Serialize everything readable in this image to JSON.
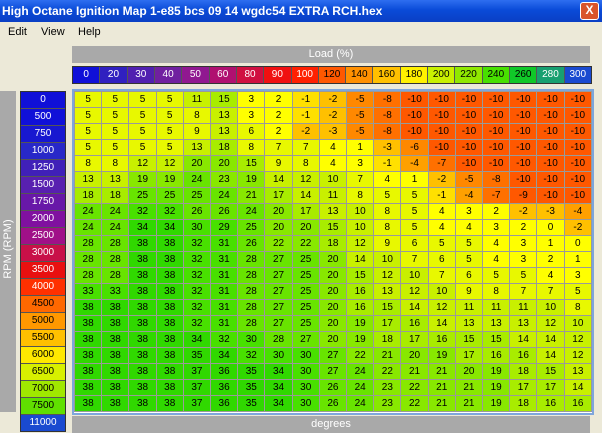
{
  "window": {
    "title": "High Octane Ignition Map 1-e85  bcs 09 14 wgdc54 EXTRA RCH.hex",
    "close_label": "X"
  },
  "menu": [
    "Edit",
    "View",
    "Help"
  ],
  "x_axis_label": "Load (%)",
  "y_axis_label": "RPM (RPM)",
  "bottom_label": "degrees",
  "load_columns": [
    {
      "label": "0",
      "color": "#1010d8",
      "text": "#ffffff"
    },
    {
      "label": "20",
      "color": "#3020c0",
      "text": "#ffffff"
    },
    {
      "label": "30",
      "color": "#5020b0",
      "text": "#ffffff"
    },
    {
      "label": "40",
      "color": "#7020a0",
      "text": "#ffffff"
    },
    {
      "label": "50",
      "color": "#901890",
      "text": "#ffffff"
    },
    {
      "label": "60",
      "color": "#b01070",
      "text": "#ffffff"
    },
    {
      "label": "80",
      "color": "#d01040",
      "text": "#ffffff"
    },
    {
      "label": "90",
      "color": "#f01010",
      "text": "#ffffff"
    },
    {
      "label": "100",
      "color": "#ff2000",
      "text": "#ffffff"
    },
    {
      "label": "120",
      "color": "#ff5800",
      "text": "#000000"
    },
    {
      "label": "140",
      "color": "#ff9000",
      "text": "#000000"
    },
    {
      "label": "160",
      "color": "#ffc000",
      "text": "#000000"
    },
    {
      "label": "180",
      "color": "#fff000",
      "text": "#000000"
    },
    {
      "label": "200",
      "color": "#c8f000",
      "text": "#000000"
    },
    {
      "label": "220",
      "color": "#90e800",
      "text": "#000000"
    },
    {
      "label": "240",
      "color": "#48e000",
      "text": "#000000"
    },
    {
      "label": "260",
      "color": "#10c828",
      "text": "#000000"
    },
    {
      "label": "280",
      "color": "#18a070",
      "text": "#ffffff"
    },
    {
      "label": "300",
      "color": "#1a4ad0",
      "text": "#ffffff"
    }
  ],
  "rpm_rows": [
    {
      "label": "0",
      "color": "#1010d8",
      "text": "#ffffff"
    },
    {
      "label": "500",
      "color": "#1010d8",
      "text": "#ffffff"
    },
    {
      "label": "750",
      "color": "#1818d0",
      "text": "#ffffff"
    },
    {
      "label": "1000",
      "color": "#2828c8",
      "text": "#ffffff"
    },
    {
      "label": "1250",
      "color": "#4020b8",
      "text": "#ffffff"
    },
    {
      "label": "1500",
      "color": "#5820b0",
      "text": "#ffffff"
    },
    {
      "label": "1750",
      "color": "#6818a8",
      "text": "#ffffff"
    },
    {
      "label": "2000",
      "color": "#8010a0",
      "text": "#ffffff"
    },
    {
      "label": "2500",
      "color": "#a01088",
      "text": "#ffffff"
    },
    {
      "label": "3000",
      "color": "#c81048",
      "text": "#ffffff"
    },
    {
      "label": "3500",
      "color": "#e81010",
      "text": "#ffffff"
    },
    {
      "label": "4000",
      "color": "#ff3000",
      "text": "#ffffff"
    },
    {
      "label": "4500",
      "color": "#ff6800",
      "text": "#000000"
    },
    {
      "label": "5000",
      "color": "#ff9800",
      "text": "#000000"
    },
    {
      "label": "5500",
      "color": "#ffc000",
      "text": "#000000"
    },
    {
      "label": "6000",
      "color": "#ffe800",
      "text": "#000000"
    },
    {
      "label": "6500",
      "color": "#d8f000",
      "text": "#000000"
    },
    {
      "label": "7000",
      "color": "#a0e800",
      "text": "#000000"
    },
    {
      "label": "7500",
      "color": "#60e000",
      "text": "#000000"
    },
    {
      "label": "11000",
      "color": "#1a4ad0",
      "text": "#ffffff"
    }
  ],
  "grid": [
    [
      "5",
      "5",
      "5",
      "5",
      "11",
      "15",
      "3",
      "2",
      "-1",
      "-2",
      "-5",
      "-8",
      "-10",
      "-10",
      "-10",
      "-10",
      "-10",
      "-10",
      "-10"
    ],
    [
      "5",
      "5",
      "5",
      "5",
      "8",
      "13",
      "3",
      "2",
      "-1",
      "-2",
      "-5",
      "-8",
      "-10",
      "-10",
      "-10",
      "-10",
      "-10",
      "-10",
      "-10"
    ],
    [
      "5",
      "5",
      "5",
      "5",
      "9",
      "13",
      "6",
      "2",
      "-2",
      "-3",
      "-5",
      "-8",
      "-10",
      "-10",
      "-10",
      "-10",
      "-10",
      "-10",
      "-10"
    ],
    [
      "5",
      "5",
      "5",
      "5",
      "13",
      "18",
      "8",
      "7",
      "7",
      "4",
      "1",
      "-3",
      "-6",
      "-10",
      "-10",
      "-10",
      "-10",
      "-10",
      "-10"
    ],
    [
      "8",
      "8",
      "12",
      "12",
      "20",
      "20",
      "15",
      "9",
      "8",
      "4",
      "3",
      "-1",
      "-4",
      "-7",
      "-10",
      "-10",
      "-10",
      "-10",
      "-10"
    ],
    [
      "13",
      "13",
      "19",
      "19",
      "24",
      "23",
      "19",
      "14",
      "12",
      "10",
      "7",
      "4",
      "1",
      "-2",
      "-5",
      "-8",
      "-10",
      "-10",
      "-10"
    ],
    [
      "18",
      "18",
      "25",
      "25",
      "25",
      "24",
      "21",
      "17",
      "14",
      "11",
      "8",
      "5",
      "5",
      "-1",
      "-4",
      "-7",
      "-9",
      "-10",
      "-10"
    ],
    [
      "24",
      "24",
      "32",
      "32",
      "26",
      "26",
      "24",
      "20",
      "17",
      "13",
      "10",
      "8",
      "5",
      "4",
      "3",
      "2",
      "-2",
      "-3",
      "-4"
    ],
    [
      "24",
      "24",
      "34",
      "34",
      "30",
      "29",
      "25",
      "20",
      "20",
      "15",
      "10",
      "8",
      "5",
      "4",
      "4",
      "3",
      "2",
      "0",
      "-2"
    ],
    [
      "28",
      "28",
      "38",
      "38",
      "32",
      "31",
      "26",
      "22",
      "22",
      "18",
      "12",
      "9",
      "6",
      "5",
      "5",
      "4",
      "3",
      "1",
      "0"
    ],
    [
      "28",
      "28",
      "38",
      "38",
      "32",
      "31",
      "28",
      "27",
      "25",
      "20",
      "14",
      "10",
      "7",
      "6",
      "5",
      "4",
      "3",
      "2",
      "1"
    ],
    [
      "28",
      "28",
      "38",
      "38",
      "32",
      "31",
      "28",
      "27",
      "25",
      "20",
      "15",
      "12",
      "10",
      "7",
      "6",
      "5",
      "5",
      "4",
      "3"
    ],
    [
      "33",
      "33",
      "38",
      "38",
      "32",
      "31",
      "28",
      "27",
      "25",
      "20",
      "16",
      "13",
      "12",
      "10",
      "9",
      "8",
      "7",
      "7",
      "5"
    ],
    [
      "38",
      "38",
      "38",
      "38",
      "32",
      "31",
      "28",
      "27",
      "25",
      "20",
      "16",
      "15",
      "14",
      "12",
      "11",
      "11",
      "11",
      "10",
      "8"
    ],
    [
      "38",
      "38",
      "38",
      "38",
      "32",
      "31",
      "28",
      "27",
      "25",
      "20",
      "19",
      "17",
      "16",
      "14",
      "13",
      "13",
      "13",
      "12",
      "10"
    ],
    [
      "38",
      "38",
      "38",
      "38",
      "34",
      "32",
      "30",
      "28",
      "27",
      "20",
      "19",
      "18",
      "17",
      "16",
      "15",
      "15",
      "14",
      "14",
      "12"
    ],
    [
      "38",
      "38",
      "38",
      "38",
      "35",
      "34",
      "32",
      "30",
      "30",
      "27",
      "22",
      "21",
      "20",
      "19",
      "17",
      "16",
      "16",
      "14",
      "12"
    ],
    [
      "38",
      "38",
      "38",
      "38",
      "37",
      "36",
      "35",
      "34",
      "30",
      "27",
      "24",
      "22",
      "21",
      "21",
      "20",
      "19",
      "18",
      "15",
      "13"
    ],
    [
      "38",
      "38",
      "38",
      "38",
      "37",
      "36",
      "35",
      "34",
      "30",
      "26",
      "24",
      "23",
      "22",
      "21",
      "21",
      "19",
      "17",
      "17",
      "14"
    ],
    [
      "38",
      "38",
      "38",
      "38",
      "37",
      "36",
      "35",
      "34",
      "30",
      "26",
      "24",
      "23",
      "22",
      "21",
      "21",
      "19",
      "18",
      "16",
      "16"
    ]
  ],
  "cell_colors": {
    "pos": [
      "#ffff00",
      "#e8f800",
      "#c8f000",
      "#a8ec00",
      "#88e800",
      "#68e400",
      "#48e000",
      "#30d800"
    ],
    "neg": [
      "#ffe000",
      "#ffc000",
      "#ffa000",
      "#ff8800",
      "#ff7000",
      "#ff5800"
    ]
  }
}
